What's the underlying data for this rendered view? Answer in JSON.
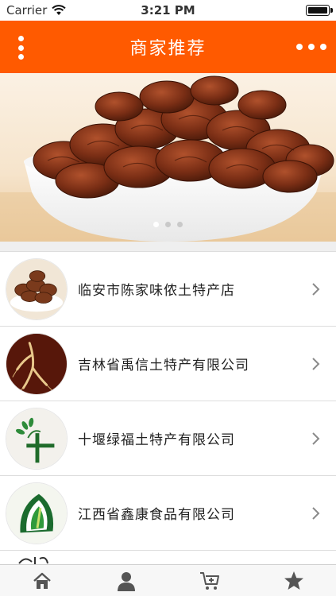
{
  "status_bar": {
    "carrier": "Carrier",
    "time": "3:21 PM",
    "icons": [
      "wifi-icon",
      "battery-icon"
    ]
  },
  "nav": {
    "title": "商家推荐",
    "left_icon": "vertical-dots-icon",
    "right_icon": "more-horizontal-icon",
    "bg_color": "#ff5a00"
  },
  "banner": {
    "image": "bowl-of-candied-pecans",
    "pages": 3,
    "active_page": 1
  },
  "stores": [
    {
      "name": "临安市陈家味侬土特产店",
      "image": "pecans-thumbnail"
    },
    {
      "name": "吉林省禹信土特产有限公司",
      "image": "ginseng-root-thumbnail"
    },
    {
      "name": "十堰绿福土特产有限公司",
      "image": "green-leaf-cross-logo"
    },
    {
      "name": "江西省鑫康食品有限公司",
      "image": "green-leaf-logo"
    }
  ],
  "tabs": [
    {
      "icon": "home-icon"
    },
    {
      "icon": "user-icon"
    },
    {
      "icon": "cart-add-icon"
    },
    {
      "icon": "star-icon"
    }
  ],
  "colors": {
    "accent": "#ff5a00",
    "icon_gray": "#555555"
  }
}
